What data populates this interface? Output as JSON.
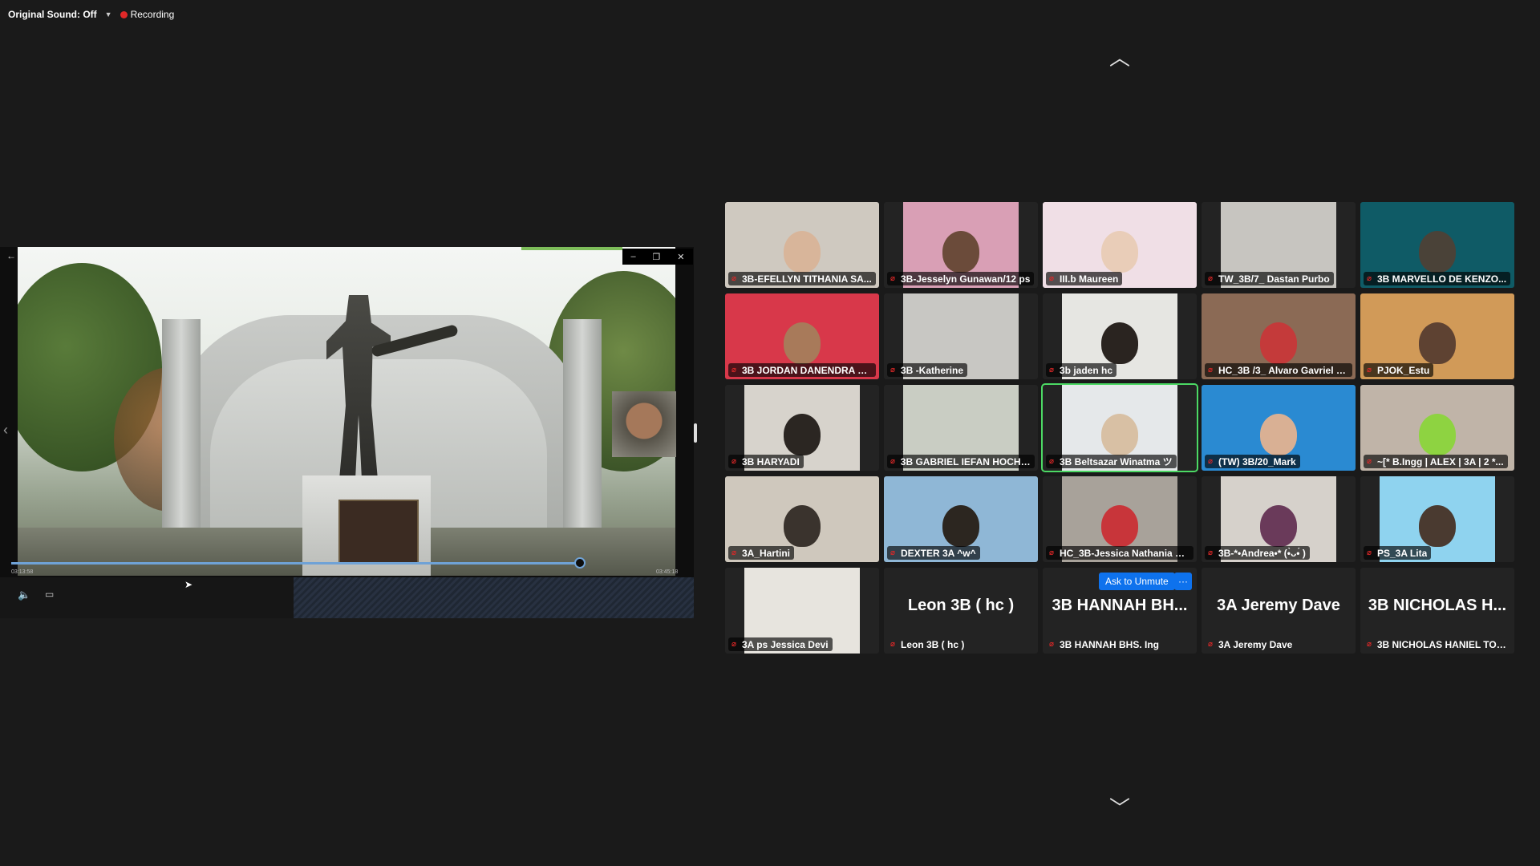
{
  "topbar": {
    "original_sound": "Original Sound: Off",
    "recording": "Recording"
  },
  "share": {
    "time_elapsed": "03:13:58",
    "time_total": "03:45:18"
  },
  "gallery": {
    "ask_to_unmute": "Ask to Unmute",
    "more": "···",
    "participants": [
      {
        "label": "3B-EFELLYN TITHANIA SA...",
        "bg": "#cfc9c0",
        "face": "#d8b59a"
      },
      {
        "label": "3B-Jesselyn Gunawan/12 ps",
        "bg": "#d99fb5",
        "face": "#6b4b3a"
      },
      {
        "label": "III.b Maureen",
        "bg": "#f0dfe6",
        "face": "#e9cdb8"
      },
      {
        "label": "TW_3B/7_ Dastan Purbo",
        "bg": "#c7c5c0",
        "face": ""
      },
      {
        "label": "3B MARVELLO DE KENZO...",
        "bg": "#0f5b66",
        "face": "#4a4238"
      },
      {
        "label": "3B JORDAN DANENDRA S...",
        "bg": "#d8384a",
        "face": "#a87a5a"
      },
      {
        "label": "3B -Katherine",
        "bg": "#c8c7c3",
        "face": ""
      },
      {
        "label": "3b jaden hc",
        "bg": "#e6e6e2",
        "face": "#2a2420"
      },
      {
        "label": "HC_3B /3_ Alvaro Gavriel P...",
        "bg": "#8b6a55",
        "face": "#c43a3a"
      },
      {
        "label": "PJOK_Estu",
        "bg": "#d19a58",
        "face": "#5e4232"
      },
      {
        "label": "3B HARYADI",
        "bg": "#d7d3cc",
        "face": "#2b2622"
      },
      {
        "label": "3B GABRIEL IEFAN HOCHEN",
        "bg": "#c9cdc3",
        "face": ""
      },
      {
        "label": "3B Beltsazar Winatma ツ",
        "bg": "#e5e8ea",
        "face": "#d8c0a4"
      },
      {
        "label": "(TW) 3B/20_Mark",
        "bg": "#2a8ad2",
        "face": "#d9b094"
      },
      {
        "label": "~[* B.Ingg | ALEX | 3A | 2 *...",
        "bg": "#c0b4a8",
        "face": "#8ed341"
      },
      {
        "label": "3A_Hartini",
        "bg": "#cfc8bd",
        "face": "#3a332d"
      },
      {
        "label": "DEXTER 3A ^w^",
        "bg": "#8fb7d6",
        "face": "#2c2620"
      },
      {
        "label": "HC_3B-Jessica Nathania H...",
        "bg": "#a8a29a",
        "face": "#c8353a"
      },
      {
        "label": "3B-*•Andrea•* (•̀ᴗ•́ )",
        "bg": "#d6d1cb",
        "face": "#6a3a5a"
      },
      {
        "label": "PS_3A Lita",
        "bg": "#8fd3ef",
        "face": "#4a3a30"
      },
      {
        "label": "3A ps Jessica Devi",
        "bg": "#e7e4de",
        "face": ""
      },
      {
        "label": "Leon 3B ( hc )",
        "big": "Leon 3B ( hc )"
      },
      {
        "label": "3B HANNAH BHS. Ing",
        "big": "3B HANNAH BH..."
      },
      {
        "label": "3A Jeremy Dave",
        "big": "3A Jeremy Dave"
      },
      {
        "label": "3B NICHOLAS HANIEL TOHA",
        "big": "3B NICHOLAS H..."
      }
    ]
  }
}
